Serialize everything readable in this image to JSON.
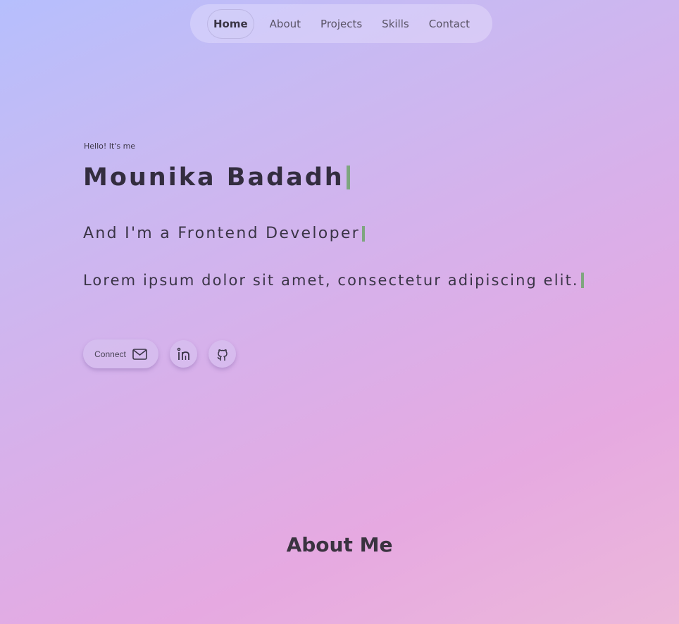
{
  "nav": {
    "items": [
      {
        "label": "Home",
        "active": true
      },
      {
        "label": "About",
        "active": false
      },
      {
        "label": "Projects",
        "active": false
      },
      {
        "label": "Skills",
        "active": false
      },
      {
        "label": "Contact",
        "active": false
      }
    ]
  },
  "hero": {
    "greeting": "Hello! It's me",
    "name": "Mounika Badadh",
    "role": "And I'm a Frontend Developer",
    "tagline": "Lorem ipsum dolor sit amet, consectetur adipiscing elit."
  },
  "socials": {
    "connect_label": "Connect",
    "icons": [
      "mail-icon",
      "linkedin-icon",
      "github-icon"
    ]
  },
  "about": {
    "heading": "About Me"
  },
  "colors": {
    "caret": "#7ea67f",
    "text": "#332d3f"
  }
}
